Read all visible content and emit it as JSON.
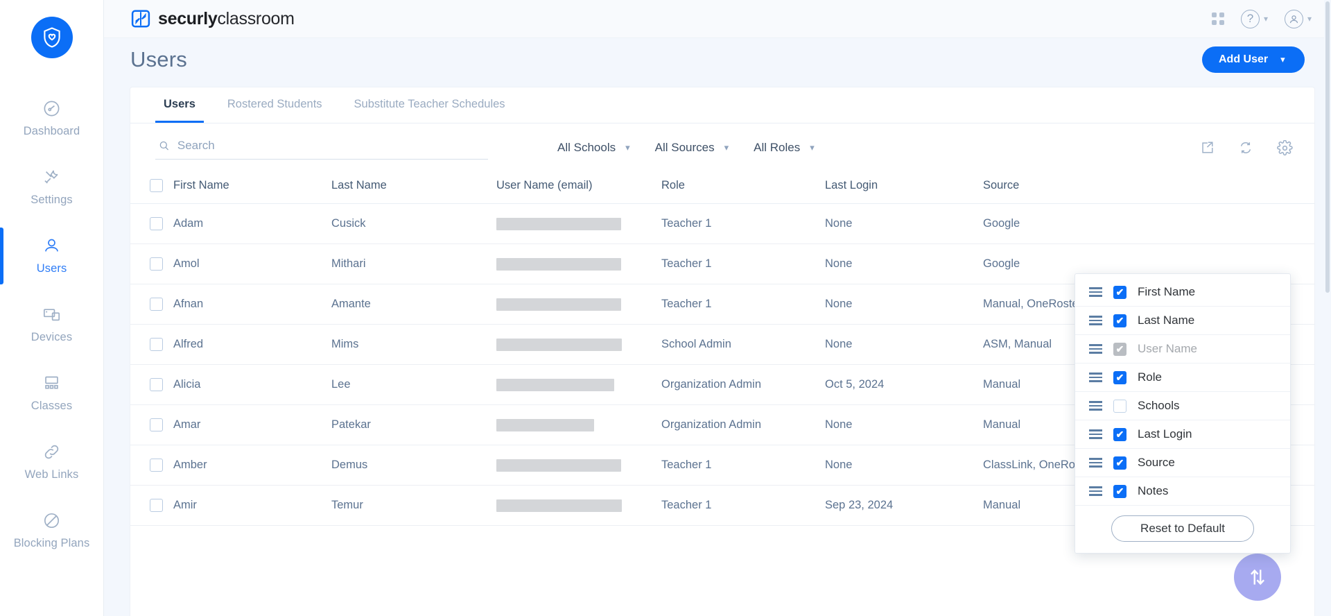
{
  "sidebar": {
    "logo_icon": "securly-shield-logo",
    "items": [
      {
        "label": "Dashboard",
        "icon": "speedometer-icon",
        "active": false
      },
      {
        "label": "Settings",
        "icon": "tools-icon",
        "active": false
      },
      {
        "label": "Users",
        "icon": "person-icon",
        "active": true
      },
      {
        "label": "Devices",
        "icon": "devices-icon",
        "active": false
      },
      {
        "label": "Classes",
        "icon": "classroom-icon",
        "active": false
      },
      {
        "label": "Web Links",
        "icon": "link-icon",
        "active": false
      },
      {
        "label": "Blocking Plans",
        "icon": "block-circle-icon",
        "active": false
      }
    ]
  },
  "topbar": {
    "brand_bold": "securly",
    "brand_light": "classroom",
    "apps_icon": "grid-apps-icon",
    "help_icon": "help-circle-icon",
    "account_icon": "account-circle-icon"
  },
  "header": {
    "title": "Users",
    "add_user_label": "Add User",
    "add_user_caret": "⌄"
  },
  "tabs": [
    {
      "label": "Users",
      "active": true
    },
    {
      "label": "Rostered Students",
      "active": false
    },
    {
      "label": "Substitute Teacher Schedules",
      "active": false
    }
  ],
  "toolbar": {
    "search_placeholder": "Search",
    "search_value": "",
    "search_icon": "search-icon",
    "filters": [
      {
        "label": "All Schools"
      },
      {
        "label": "All Sources"
      },
      {
        "label": "All Roles"
      }
    ],
    "icons": [
      {
        "name": "export-icon"
      },
      {
        "name": "refresh-icon"
      },
      {
        "name": "gear-icon"
      }
    ]
  },
  "table": {
    "columns": [
      "First Name",
      "Last Name",
      "User Name (email)",
      "Role",
      "Last Login",
      "Source"
    ],
    "rows": [
      {
        "first": "Adam",
        "last": "Cusick",
        "email_redacted_w": 180,
        "role": "Teacher 1",
        "login": "None",
        "source": "Google"
      },
      {
        "first": "Amol",
        "last": "Mithari",
        "email_redacted_w": 180,
        "role": "Teacher 1",
        "login": "None",
        "source": "Google"
      },
      {
        "first": "Afnan",
        "last": "Amante",
        "email_redacted_w": 180,
        "role": "Teacher 1",
        "login": "None",
        "source": "Manual, OneRoster"
      },
      {
        "first": "Alfred",
        "last": "Mims",
        "email_redacted_w": 181,
        "role": "School Admin",
        "login": "None",
        "source": "ASM, Manual"
      },
      {
        "first": "Alicia",
        "last": "Lee",
        "email_redacted_w": 170,
        "role": "Organization Admin",
        "login": "Oct 5, 2024",
        "source": "Manual"
      },
      {
        "first": "Amar",
        "last": "Patekar",
        "email_redacted_w": 141,
        "role": "Organization Admin",
        "login": "None",
        "source": "Manual"
      },
      {
        "first": "Amber",
        "last": "Demus",
        "email_redacted_w": 180,
        "role": "Teacher 1",
        "login": "None",
        "source": "ClassLink, OneRoster"
      },
      {
        "first": "Amir",
        "last": "Temur",
        "email_redacted_w": 181,
        "role": "Teacher 1",
        "login": "Sep 23, 2024",
        "source": "Manual"
      }
    ]
  },
  "column_menu": {
    "items": [
      {
        "label": "First Name",
        "state": "checked"
      },
      {
        "label": "Last Name",
        "state": "checked"
      },
      {
        "label": "User Name",
        "state": "disabled"
      },
      {
        "label": "Role",
        "state": "checked"
      },
      {
        "label": "Schools",
        "state": "unchecked"
      },
      {
        "label": "Last Login",
        "state": "checked"
      },
      {
        "label": "Source",
        "state": "checked"
      },
      {
        "label": "Notes",
        "state": "checked"
      }
    ],
    "reset_label": "Reset to Default",
    "check_glyph": "✔",
    "drag_icon": "drag-handle-icon"
  },
  "fab": {
    "icon": "sort-updown-icon"
  },
  "colors": {
    "accent": "#0b6ef6",
    "fab": "#a7aaf0",
    "muted": "#8fa3bd"
  }
}
